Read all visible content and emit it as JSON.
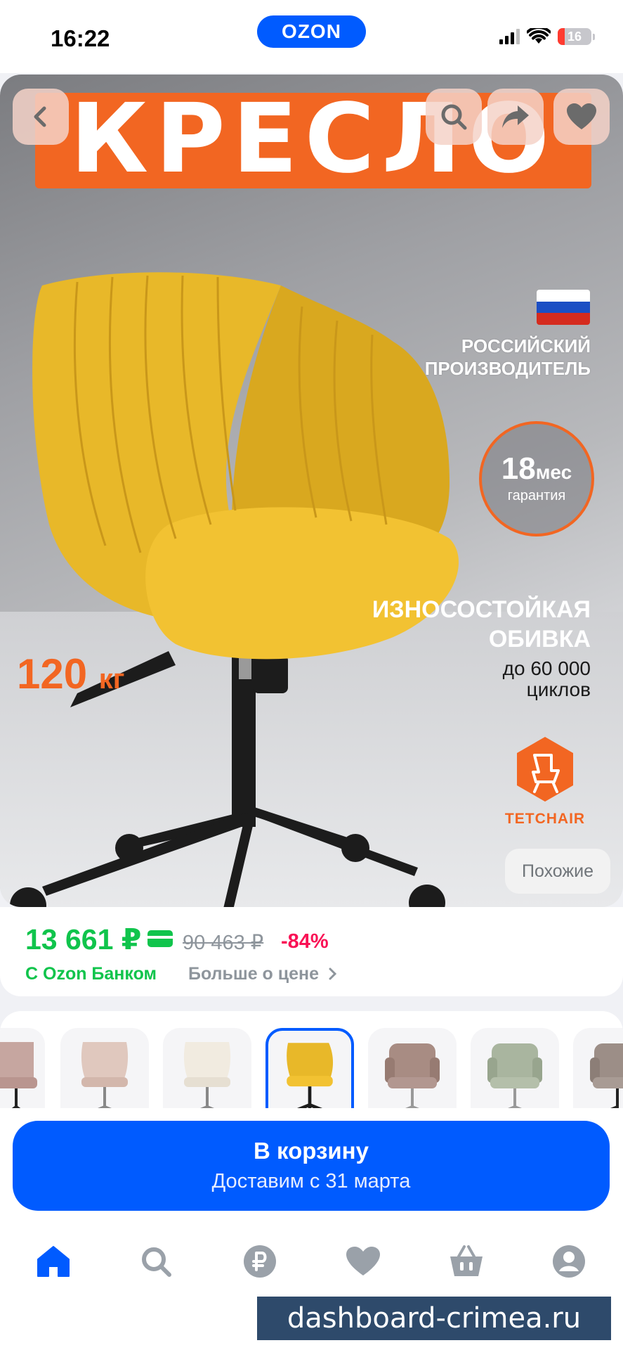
{
  "status_bar": {
    "time": "16:22",
    "logo": "OZON",
    "battery": "16"
  },
  "hero": {
    "banner": "КРЕСЛО",
    "maker_line1": "РОССИЙСКИЙ",
    "maker_line2": "ПРОИЗВОДИТЕЛЬ",
    "warranty_num": "18",
    "warranty_unit": "мес",
    "warranty_label": "гарантия",
    "wear_line1": "ИЗНОСОСТОЙКАЯ",
    "wear_line2": "ОБИВКА",
    "cycles_line1": "до 60 000",
    "cycles_line2": "циклов",
    "load_num": "120",
    "load_unit": "кг",
    "brand": "TETCHAIR",
    "similar_button": "Похожие",
    "icons": [
      "back-icon",
      "search-icon",
      "share-icon",
      "heart-icon"
    ]
  },
  "price": {
    "current": "13 661 ₽",
    "old": "90 463 ₽",
    "discount": "-84%",
    "bank_label": "С Ozon Банком",
    "more_label": "Больше о цене"
  },
  "variants": [
    "pink",
    "beige-pink",
    "cream",
    "yellow",
    "mauve",
    "sage",
    "taupe"
  ],
  "selected_variant": "yellow",
  "cart": {
    "button_label": "В корзину",
    "delivery": "Доставим с 31 марта"
  },
  "tabbar": [
    "home-icon",
    "search-icon",
    "ruble-icon",
    "heart-icon",
    "basket-icon",
    "profile-icon"
  ],
  "watermark": "dashboard-crimea.ru",
  "colors": {
    "accent": "#005bff",
    "price_green": "#10c44c",
    "discount": "#f91155",
    "brand_orange": "#f26622"
  }
}
